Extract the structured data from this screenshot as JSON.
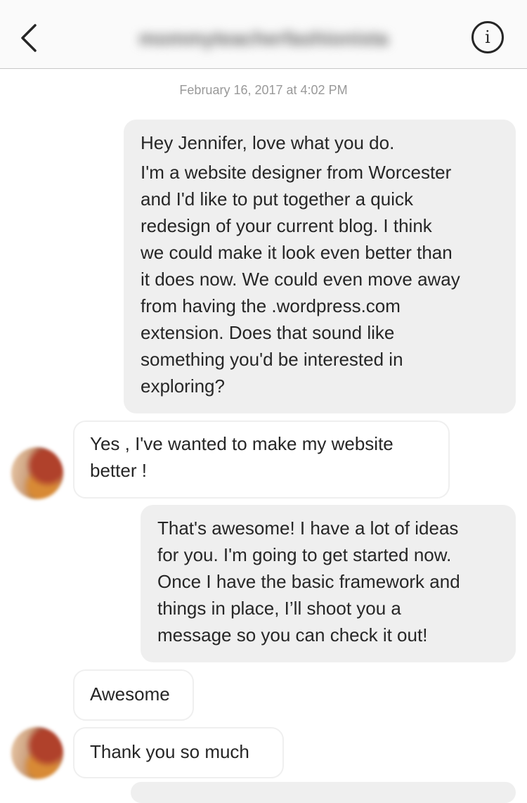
{
  "header": {
    "title": "mommyteacherfashionista",
    "back_icon": "chevron-left-icon",
    "info_icon": "info-icon",
    "info_glyph": "i"
  },
  "conversation": {
    "timestamp": "February 16, 2017 at 4:02 PM",
    "messages": [
      {
        "from": "me",
        "lines": [
          "Hey Jennifer, love what you do.",
          "I'm a website designer from Worcester",
          "and I'd like to put together a quick",
          "redesign of your current blog. I think",
          "we could make it look even better than",
          "it does now. We could even move away",
          "from having the .wordpress.com",
          "extension. Does that sound like",
          "something you'd be interested in",
          "exploring?"
        ]
      },
      {
        "from": "them",
        "lines": [
          "Yes , I've wanted to make my website",
          "better !"
        ]
      },
      {
        "from": "me",
        "lines": [
          "That's awesome! I have a lot of ideas",
          "for you. I'm going to get started now.",
          "Once I have the basic framework and",
          "things in place, I’ll shoot you a",
          "message so you can check it out!"
        ]
      },
      {
        "from": "them",
        "lines": [
          "Awesome"
        ]
      },
      {
        "from": "them",
        "lines": [
          "Thank you so much"
        ]
      }
    ]
  },
  "colors": {
    "sent_bubble": "#efefef",
    "received_border": "#efefef",
    "text": "#262626",
    "timestamp": "#999999"
  }
}
